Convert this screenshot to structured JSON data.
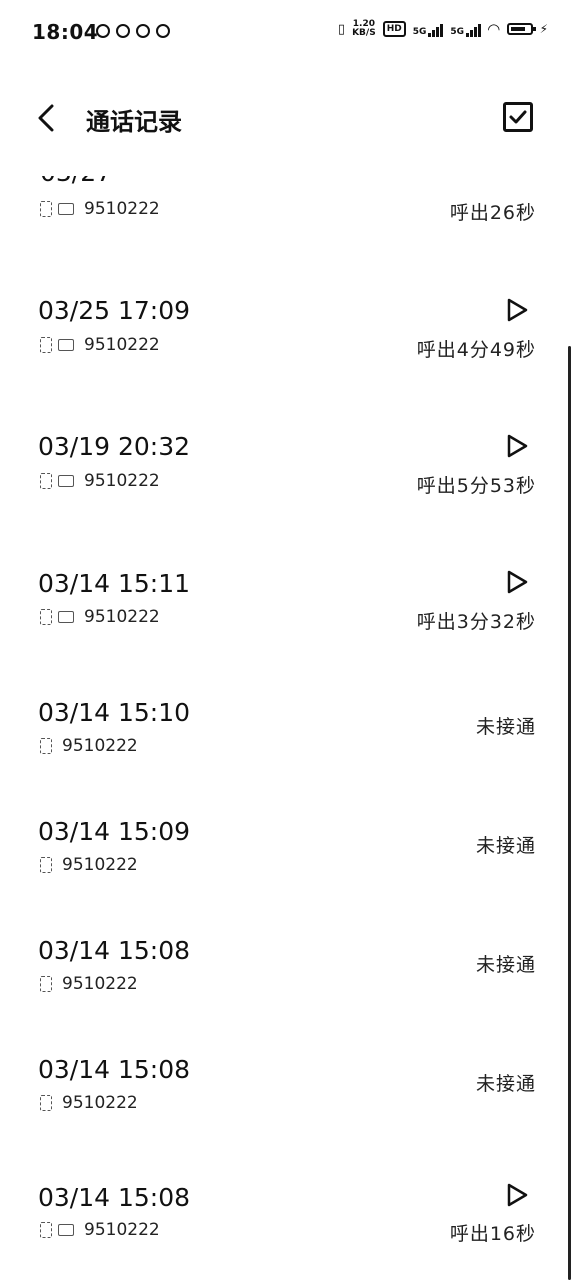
{
  "status_bar": {
    "time": "18:04",
    "speed_value": "1.20",
    "speed_unit": "KB/S",
    "hd_label": "HD",
    "net1": "5G",
    "net2": "5G"
  },
  "header": {
    "title": "通话记录"
  },
  "calls": [
    {
      "date": "",
      "number": "9510222",
      "status": "呼出26秒",
      "has_play": false,
      "has_rec": true
    },
    {
      "date": "03/25 17:09",
      "number": "9510222",
      "status": "呼出4分49秒",
      "has_play": true,
      "has_rec": true
    },
    {
      "date": "03/19 20:32",
      "number": "9510222",
      "status": "呼出5分53秒",
      "has_play": true,
      "has_rec": true
    },
    {
      "date": "03/14 15:11",
      "number": "9510222",
      "status": "呼出3分32秒",
      "has_play": true,
      "has_rec": true
    },
    {
      "date": "03/14 15:10",
      "number": "9510222",
      "status": "未接通",
      "has_play": false,
      "has_rec": false
    },
    {
      "date": "03/14 15:09",
      "number": "9510222",
      "status": "未接通",
      "has_play": false,
      "has_rec": false
    },
    {
      "date": "03/14 15:08",
      "number": "9510222",
      "status": "未接通",
      "has_play": false,
      "has_rec": false
    },
    {
      "date": "03/14 15:08",
      "number": "9510222",
      "status": "未接通",
      "has_play": false,
      "has_rec": false
    },
    {
      "date": "03/14 15:08",
      "number": "9510222",
      "status": "呼出16秒",
      "has_play": true,
      "has_rec": true
    }
  ],
  "icons": {
    "back": "chevron-left-icon",
    "select": "checkbox-checked-icon",
    "play": "play-outline-icon",
    "sim": "sim-card-icon",
    "recording": "recording-icon"
  }
}
